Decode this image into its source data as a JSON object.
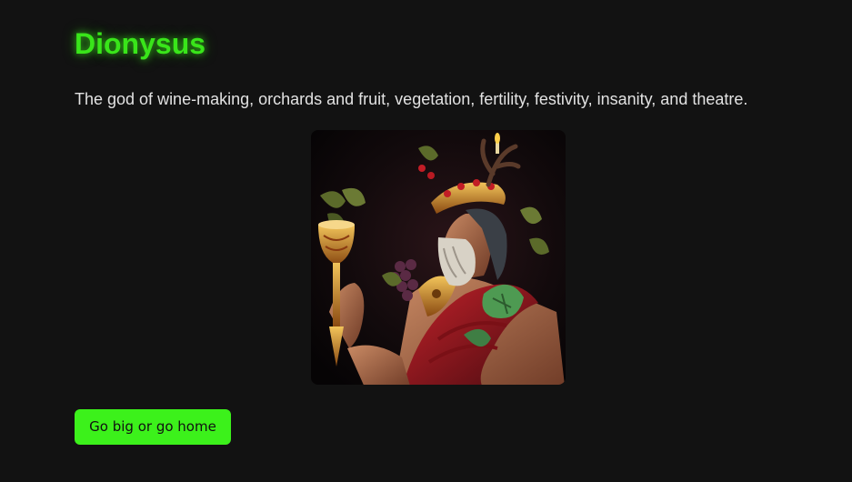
{
  "hero": {
    "title": "Dionysus",
    "description": "The god of wine-making, orchards and fruit, vegetation, fertility, festivity, insanity, and theatre.",
    "image_subject": "Dionysus portrait holding golden goblet, wearing grape-vine crown with antlers, red drapery"
  },
  "cta": {
    "label": "Go big or go home"
  },
  "colors": {
    "background": "#121212",
    "accent": "#39e51a",
    "button": "#3cf11b",
    "text": "#e2e2e2"
  }
}
